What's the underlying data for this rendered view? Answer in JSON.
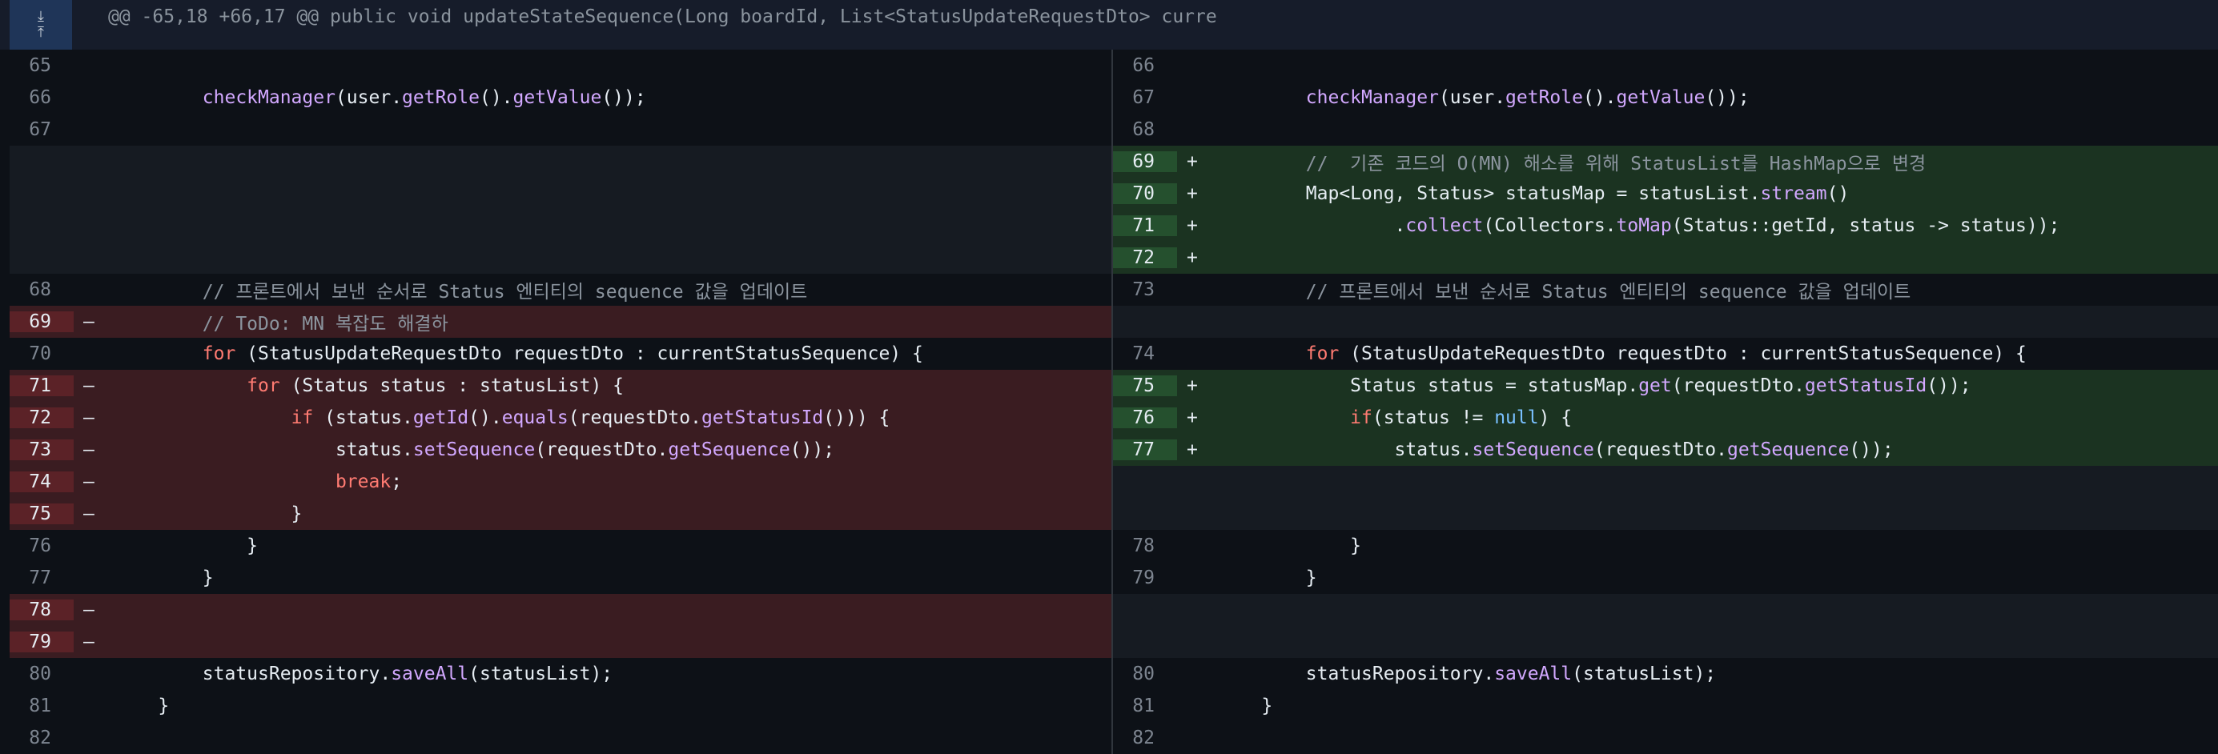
{
  "hunk": {
    "header": "@@ -65,18 +66,17 @@ public void updateStateSequence(Long boardId, List<StatusUpdateRequestDto> curre",
    "expand_up_icon": "arrow-down-icon",
    "expand_down_icon": "arrow-up-icon"
  },
  "left": [
    {
      "type": "ctx",
      "ln": "65",
      "tokens": []
    },
    {
      "type": "ctx",
      "ln": "66",
      "tokens": [
        {
          "t": "        "
        },
        {
          "t": "checkManager",
          "c": "fn"
        },
        {
          "t": "(user."
        },
        {
          "t": "getRole",
          "c": "fn"
        },
        {
          "t": "()."
        },
        {
          "t": "getValue",
          "c": "fn"
        },
        {
          "t": "());"
        }
      ]
    },
    {
      "type": "ctx",
      "ln": "67",
      "tokens": []
    },
    {
      "type": "empty"
    },
    {
      "type": "empty"
    },
    {
      "type": "empty"
    },
    {
      "type": "empty"
    },
    {
      "type": "ctx",
      "ln": "68",
      "tokens": [
        {
          "t": "        "
        },
        {
          "t": "// 프론트에서 보낸 순서로 Status 엔티티의 sequence 값을 업데이트",
          "c": "cm"
        }
      ]
    },
    {
      "type": "del",
      "ln": "69",
      "sign": "–",
      "tokens": [
        {
          "t": "        "
        },
        {
          "t": "// ToDo: MN 복잡도 해결하",
          "c": "cm"
        }
      ]
    },
    {
      "type": "ctx",
      "ln": "70",
      "tokens": [
        {
          "t": "        "
        },
        {
          "t": "for",
          "c": "kw"
        },
        {
          "t": " (StatusUpdateRequestDto requestDto : currentStatusSequence) {"
        }
      ]
    },
    {
      "type": "del",
      "ln": "71",
      "sign": "–",
      "tokens": [
        {
          "t": "            "
        },
        {
          "t": "for",
          "c": "kw"
        },
        {
          "t": " (Status status : statusList) {"
        }
      ]
    },
    {
      "type": "del",
      "ln": "72",
      "sign": "–",
      "tokens": [
        {
          "t": "                "
        },
        {
          "t": "if",
          "c": "kw"
        },
        {
          "t": " (status."
        },
        {
          "t": "getId",
          "c": "fn"
        },
        {
          "t": "()."
        },
        {
          "t": "equals",
          "c": "fn"
        },
        {
          "t": "(requestDto."
        },
        {
          "t": "getStatusId",
          "c": "fn"
        },
        {
          "t": "())) {"
        }
      ]
    },
    {
      "type": "del",
      "ln": "73",
      "sign": "–",
      "tokens": [
        {
          "t": "                    status."
        },
        {
          "t": "setSequence",
          "c": "fn"
        },
        {
          "t": "(requestDto."
        },
        {
          "t": "getSequence",
          "c": "fn"
        },
        {
          "t": "());"
        }
      ]
    },
    {
      "type": "del",
      "ln": "74",
      "sign": "–",
      "tokens": [
        {
          "t": "                    "
        },
        {
          "t": "break",
          "c": "kw"
        },
        {
          "t": ";"
        }
      ]
    },
    {
      "type": "del",
      "ln": "75",
      "sign": "–",
      "tokens": [
        {
          "t": "                }"
        }
      ]
    },
    {
      "type": "ctx",
      "ln": "76",
      "tokens": [
        {
          "t": "            }"
        }
      ]
    },
    {
      "type": "ctx",
      "ln": "77",
      "tokens": [
        {
          "t": "        }"
        }
      ]
    },
    {
      "type": "del",
      "ln": "78",
      "sign": "–",
      "tokens": []
    },
    {
      "type": "del",
      "ln": "79",
      "sign": "–",
      "tokens": []
    },
    {
      "type": "ctx",
      "ln": "80",
      "tokens": [
        {
          "t": "        statusRepository."
        },
        {
          "t": "saveAll",
          "c": "fn"
        },
        {
          "t": "(statusList);"
        }
      ]
    },
    {
      "type": "ctx",
      "ln": "81",
      "tokens": [
        {
          "t": "    }"
        }
      ]
    },
    {
      "type": "ctx",
      "ln": "82",
      "tokens": []
    }
  ],
  "right": [
    {
      "type": "ctx",
      "ln": "66",
      "tokens": []
    },
    {
      "type": "ctx",
      "ln": "67",
      "tokens": [
        {
          "t": "        "
        },
        {
          "t": "checkManager",
          "c": "fn"
        },
        {
          "t": "(user."
        },
        {
          "t": "getRole",
          "c": "fn"
        },
        {
          "t": "()."
        },
        {
          "t": "getValue",
          "c": "fn"
        },
        {
          "t": "());"
        }
      ]
    },
    {
      "type": "ctx",
      "ln": "68",
      "tokens": []
    },
    {
      "type": "add",
      "ln": "69",
      "sign": "+",
      "tokens": [
        {
          "t": "        "
        },
        {
          "t": "//  기존 코드의 O(MN) 해소를 위해 StatusList를 HashMap으로 변경",
          "c": "cm"
        }
      ]
    },
    {
      "type": "add",
      "ln": "70",
      "sign": "+",
      "tokens": [
        {
          "t": "        Map<Long, Status> statusMap = statusList."
        },
        {
          "t": "stream",
          "c": "fn"
        },
        {
          "t": "()"
        }
      ]
    },
    {
      "type": "add",
      "ln": "71",
      "sign": "+",
      "tokens": [
        {
          "t": "                ."
        },
        {
          "t": "collect",
          "c": "fn"
        },
        {
          "t": "(Collectors."
        },
        {
          "t": "toMap",
          "c": "fn"
        },
        {
          "t": "(Status::getId, status -> status));"
        }
      ]
    },
    {
      "type": "add",
      "ln": "72",
      "sign": "+",
      "tokens": []
    },
    {
      "type": "ctx",
      "ln": "73",
      "tokens": [
        {
          "t": "        "
        },
        {
          "t": "// 프론트에서 보낸 순서로 Status 엔티티의 sequence 값을 업데이트",
          "c": "cm"
        }
      ]
    },
    {
      "type": "empty"
    },
    {
      "type": "ctx",
      "ln": "74",
      "tokens": [
        {
          "t": "        "
        },
        {
          "t": "for",
          "c": "kw"
        },
        {
          "t": " (StatusUpdateRequestDto requestDto : currentStatusSequence) {"
        }
      ]
    },
    {
      "type": "add",
      "ln": "75",
      "sign": "+",
      "tokens": [
        {
          "t": "            Status status = statusMap."
        },
        {
          "t": "get",
          "c": "fn"
        },
        {
          "t": "(requestDto."
        },
        {
          "t": "getStatusId",
          "c": "fn"
        },
        {
          "t": "());"
        }
      ]
    },
    {
      "type": "add",
      "ln": "76",
      "sign": "+",
      "tokens": [
        {
          "t": "            "
        },
        {
          "t": "if",
          "c": "kw"
        },
        {
          "t": "(status != "
        },
        {
          "t": "null",
          "c": "lit"
        },
        {
          "t": ") {"
        }
      ]
    },
    {
      "type": "add",
      "ln": "77",
      "sign": "+",
      "tokens": [
        {
          "t": "                status."
        },
        {
          "t": "setSequence",
          "c": "fn"
        },
        {
          "t": "(requestDto."
        },
        {
          "t": "getSequence",
          "c": "fn"
        },
        {
          "t": "());"
        }
      ]
    },
    {
      "type": "empty"
    },
    {
      "type": "empty"
    },
    {
      "type": "ctx",
      "ln": "78",
      "tokens": [
        {
          "t": "            }"
        }
      ]
    },
    {
      "type": "ctx",
      "ln": "79",
      "tokens": [
        {
          "t": "        }"
        }
      ]
    },
    {
      "type": "empty"
    },
    {
      "type": "empty"
    },
    {
      "type": "ctx",
      "ln": "80",
      "tokens": [
        {
          "t": "        statusRepository."
        },
        {
          "t": "saveAll",
          "c": "fn"
        },
        {
          "t": "(statusList);"
        }
      ]
    },
    {
      "type": "ctx",
      "ln": "81",
      "tokens": [
        {
          "t": "    }"
        }
      ]
    },
    {
      "type": "ctx",
      "ln": "82",
      "tokens": []
    }
  ]
}
